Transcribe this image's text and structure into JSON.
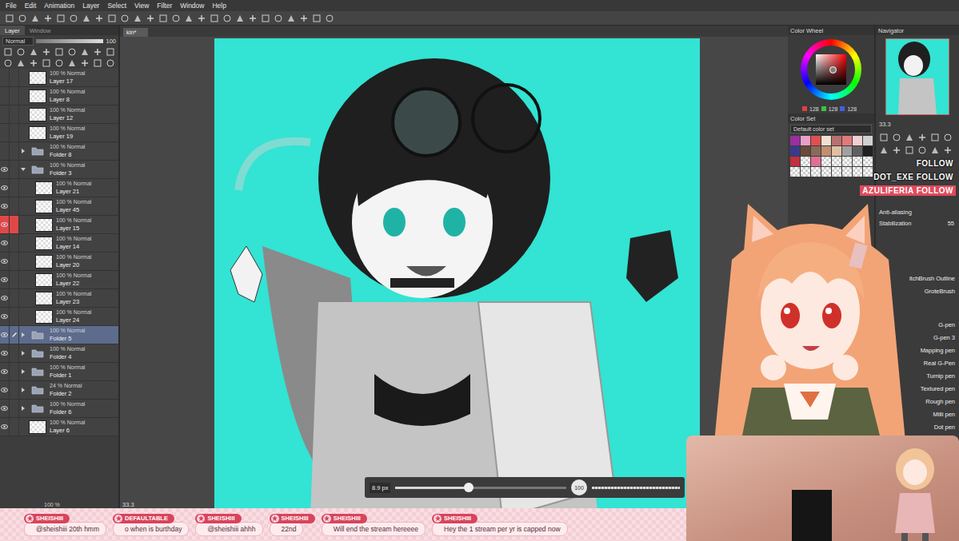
{
  "menu": [
    "File",
    "Edit",
    "Animation",
    "Layer",
    "Select",
    "View",
    "Filter",
    "Window",
    "Help"
  ],
  "layer_panel": {
    "tabs": [
      {
        "label": "Layer",
        "selected": true
      },
      {
        "label": "Window",
        "selected": false
      }
    ],
    "blend_mode": "Normal",
    "opacity": "100",
    "opacity_level": 1,
    "layers": [
      {
        "mode": "100 % Normal",
        "name": "Layer 17",
        "kind": "layer",
        "visible": false,
        "selected": false,
        "marked": false,
        "in_folder": false,
        "expanded": false
      },
      {
        "mode": "100 % Normal",
        "name": "Layer 8",
        "kind": "layer",
        "visible": false,
        "selected": false,
        "marked": false,
        "in_folder": false,
        "expanded": false
      },
      {
        "mode": "100 % Normal",
        "name": "Layer 12",
        "kind": "layer",
        "visible": false,
        "selected": false,
        "marked": false,
        "in_folder": false,
        "expanded": false
      },
      {
        "mode": "100 % Normal",
        "name": "Layer 19",
        "kind": "layer",
        "visible": false,
        "selected": false,
        "marked": false,
        "in_folder": false,
        "expanded": false
      },
      {
        "mode": "100 % Normal",
        "name": "Folder 8",
        "kind": "folder",
        "visible": false,
        "selected": false,
        "marked": false,
        "in_folder": false,
        "expanded": false
      },
      {
        "mode": "100 % Normal",
        "name": "Folder 3",
        "kind": "folder",
        "visible": true,
        "selected": false,
        "marked": false,
        "in_folder": false,
        "expanded": true
      },
      {
        "mode": "100 % Normal",
        "name": "Layer 21",
        "kind": "layer",
        "visible": true,
        "selected": false,
        "marked": false,
        "in_folder": true,
        "expanded": false
      },
      {
        "mode": "100 % Normal",
        "name": "Layer 45",
        "kind": "layer",
        "visible": true,
        "selected": false,
        "marked": false,
        "in_folder": true,
        "expanded": false
      },
      {
        "mode": "100 % Normal",
        "name": "Layer 15",
        "kind": "layer",
        "visible": true,
        "selected": false,
        "marked": true,
        "in_folder": true,
        "expanded": false
      },
      {
        "mode": "100 % Normal",
        "name": "Layer 14",
        "kind": "layer",
        "visible": true,
        "selected": false,
        "marked": false,
        "in_folder": true,
        "expanded": false
      },
      {
        "mode": "100 % Normal",
        "name": "Layer 20",
        "kind": "layer",
        "visible": true,
        "selected": false,
        "marked": false,
        "in_folder": true,
        "expanded": false
      },
      {
        "mode": "100 % Normal",
        "name": "Layer 22",
        "kind": "layer",
        "visible": true,
        "selected": false,
        "marked": false,
        "in_folder": true,
        "expanded": false
      },
      {
        "mode": "100 % Normal",
        "name": "Layer 23",
        "kind": "layer",
        "visible": true,
        "selected": false,
        "marked": false,
        "in_folder": true,
        "expanded": false
      },
      {
        "mode": "100 % Normal",
        "name": "Layer 24",
        "kind": "layer",
        "visible": true,
        "selected": false,
        "marked": false,
        "in_folder": true,
        "expanded": false
      },
      {
        "mode": "100 % Normal",
        "name": "Folder 5",
        "kind": "folder",
        "visible": true,
        "selected": true,
        "marked": false,
        "in_folder": false,
        "expanded": false
      },
      {
        "mode": "100 % Normal",
        "name": "Folder 4",
        "kind": "folder",
        "visible": true,
        "selected": false,
        "marked": false,
        "in_folder": false,
        "expanded": false
      },
      {
        "mode": "100 % Normal",
        "name": "Folder 1",
        "kind": "folder",
        "visible": true,
        "selected": false,
        "marked": false,
        "in_folder": false,
        "expanded": false
      },
      {
        "mode": "24 % Normal",
        "name": "Folder 2",
        "kind": "folder",
        "visible": true,
        "selected": false,
        "marked": false,
        "in_folder": false,
        "expanded": false
      },
      {
        "mode": "100 % Normal",
        "name": "Folder 6",
        "kind": "folder",
        "visible": true,
        "selected": false,
        "marked": false,
        "in_folder": false,
        "expanded": false
      },
      {
        "mode": "100 % Normal",
        "name": "Layer 6",
        "kind": "layer",
        "visible": true,
        "selected": false,
        "marked": false,
        "in_folder": false,
        "expanded": false
      }
    ],
    "partial_row": "100 %"
  },
  "document": {
    "tab": "kln*",
    "zoom": "33.3"
  },
  "brush_size": {
    "reading": "8.9 px",
    "level": 0.43,
    "opacity": "100",
    "opacity_level": 1
  },
  "color_wheel": {
    "title": "Color Wheel",
    "color": "#808080",
    "values": [
      "128",
      "128",
      "128"
    ]
  },
  "color_set": {
    "title": "Color Set",
    "set": "Default color set",
    "swatches": [
      {
        "kind": "color",
        "color": "#9a2f9e"
      },
      {
        "kind": "color",
        "color": "#e8a0c8"
      },
      {
        "kind": "color",
        "color": "#e05050"
      },
      {
        "kind": "color",
        "color": "#f0e0d0"
      },
      {
        "kind": "color",
        "color": "#b87070"
      },
      {
        "kind": "color",
        "color": "#e07a7a"
      },
      {
        "kind": "color",
        "color": "#f0d0d0"
      },
      {
        "kind": "color",
        "color": "#d0d0d0"
      },
      {
        "kind": "color",
        "color": "#3a3a8a"
      },
      {
        "kind": "color",
        "color": "#6a4a3a"
      },
      {
        "kind": "color",
        "color": "#8a6a5a"
      },
      {
        "kind": "color",
        "color": "#c09070"
      },
      {
        "kind": "color",
        "color": "#e0c0a0"
      },
      {
        "kind": "color",
        "color": "#a0a0a0"
      },
      {
        "kind": "color",
        "color": "#606060"
      },
      {
        "kind": "color",
        "color": "#202020"
      },
      {
        "kind": "color",
        "color": "#c03040"
      },
      {
        "kind": "empty"
      },
      {
        "kind": "color",
        "color": "#e07090"
      },
      {
        "kind": "empty"
      },
      {
        "kind": "empty"
      },
      {
        "kind": "empty"
      },
      {
        "kind": "empty"
      },
      {
        "kind": "empty"
      },
      {
        "kind": "empty"
      },
      {
        "kind": "empty"
      },
      {
        "kind": "empty"
      },
      {
        "kind": "empty"
      },
      {
        "kind": "empty"
      },
      {
        "kind": "empty"
      },
      {
        "kind": "empty"
      },
      {
        "kind": "empty"
      }
    ]
  },
  "navigator": {
    "title": "Navigator",
    "zoom": "33.3"
  },
  "tool_property": {
    "anti_aliasing": "Anti-aliasing",
    "stabilization": "Stabilization",
    "stabilization_value": "55"
  },
  "sub_tools": [
    {
      "name": "itchBrush Outline",
      "selected": false
    },
    {
      "name": "GroteBrush",
      "selected": false
    },
    {
      "name": "G-pen",
      "selected": false
    },
    {
      "name": "G-pen 3",
      "selected": false
    },
    {
      "name": "Mapping pen",
      "selected": false
    },
    {
      "name": "Real G-Pen",
      "selected": false
    },
    {
      "name": "Turnip pen",
      "selected": false
    },
    {
      "name": "Textured pen",
      "selected": false
    },
    {
      "name": "Rough pen",
      "selected": false
    },
    {
      "name": "Milli pen",
      "selected": false
    },
    {
      "name": "Dot pen",
      "selected": false
    }
  ],
  "alerts": [
    {
      "text": "FOLLOW",
      "highlighted": false
    },
    {
      "text": "DOT_EXE FOLLOW",
      "highlighted": false
    },
    {
      "text": "AZULIFERIA FOLLOW",
      "highlighted": true
    }
  ],
  "chat": [
    {
      "user": "SHEISHIII",
      "message": "@sheishiii 20th hmm"
    },
    {
      "user": "DEFAULTABLE",
      "message": "o when is burthday"
    },
    {
      "user": "SHEISHIII",
      "message": "@sheishiii ahhh"
    },
    {
      "user": "SHEISHIII",
      "message": "22nd"
    },
    {
      "user": "SHEISHIII",
      "message": "Will end the stream hereeee"
    },
    {
      "user": "SHEISHIII",
      "message": "Hey the 1 stream per yr is capped now"
    }
  ]
}
